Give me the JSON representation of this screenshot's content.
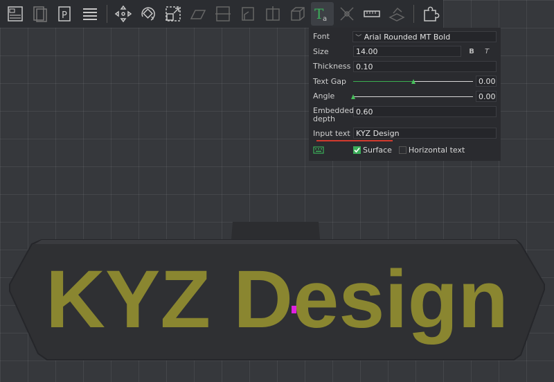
{
  "toolbar": {
    "items": [
      {
        "icon": "layout-icon"
      },
      {
        "icon": "pages-icon"
      },
      {
        "icon": "parking-icon"
      },
      {
        "icon": "list-icon"
      },
      {
        "icon": "move-icon"
      },
      {
        "icon": "rotate-icon"
      },
      {
        "icon": "scale-icon"
      },
      {
        "icon": "flatten-icon"
      },
      {
        "icon": "cut-icon"
      },
      {
        "icon": "support-icon"
      },
      {
        "icon": "seam-icon"
      },
      {
        "icon": "cube-icon"
      },
      {
        "icon": "text-tool-icon"
      },
      {
        "icon": "measure-icon"
      },
      {
        "icon": "ruler-icon"
      },
      {
        "icon": "assembly-icon"
      },
      {
        "icon": "puzzle-icon"
      }
    ]
  },
  "panel": {
    "font_label": "Font",
    "font_value": "Arial Rounded MT Bold",
    "size_label": "Size",
    "size_value": "14.00",
    "bold_label": "B",
    "italic_label": "T",
    "thickness_label": "Thickness",
    "thickness_value": "0.10",
    "text_gap_label": "Text Gap",
    "text_gap_value": "0.00",
    "text_gap_fraction": 0.5,
    "angle_label": "Angle",
    "angle_value": "0.00",
    "angle_fraction": 0.0,
    "embedded_label": "Embedded depth",
    "embedded_value": "0.60",
    "input_text_label": "Input text",
    "input_text_value": "KYZ Design",
    "surface_label": "Surface",
    "surface_checked": true,
    "horizontal_label": "Horizontal text",
    "horizontal_checked": false
  },
  "scene": {
    "model_text": "KYZ Design",
    "text_color": "#8a8630",
    "body_color": "#2f3033",
    "cursor_color": "#e020e0"
  }
}
